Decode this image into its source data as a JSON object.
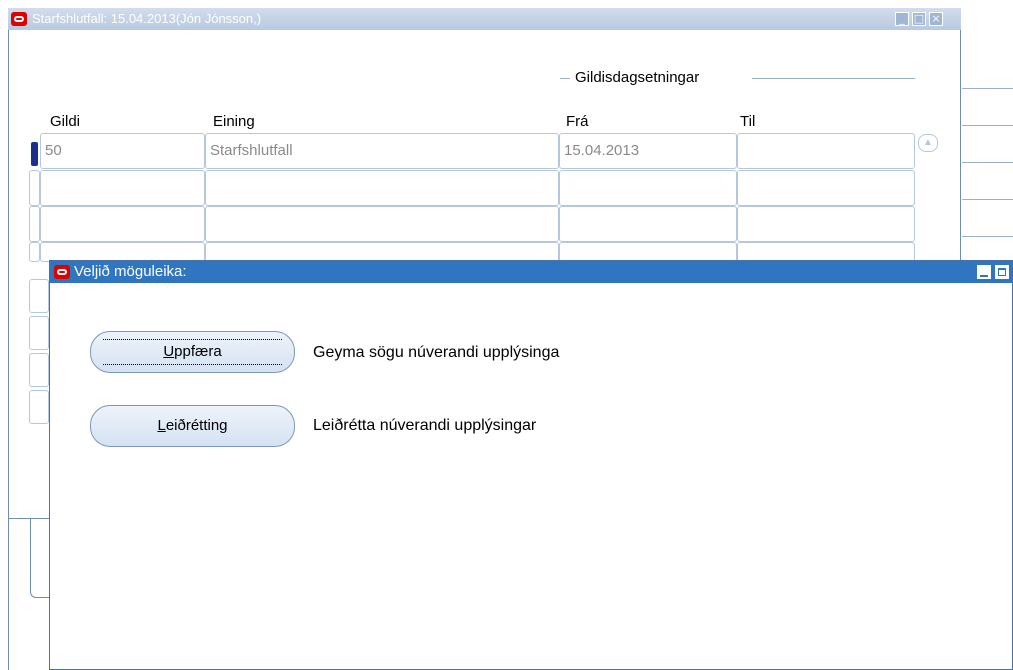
{
  "back_window": {
    "title": "Starfshlutfall: 15.04.2013(Jón Jónsson,)",
    "controls": {
      "minimize": "_",
      "maximize": "□",
      "close": "×"
    },
    "group_label": "Gildisdagsetningar",
    "columns": {
      "gildi": "Gildi",
      "eining": "Eining",
      "fra": "Frá",
      "til": "Til"
    },
    "rows": [
      {
        "gildi": "50",
        "eining": "Starfshlutfall",
        "fra": "15.04.2013",
        "til": ""
      }
    ]
  },
  "dialog": {
    "title": "Veljið möguleika:",
    "options": [
      {
        "button": "Uppfæra",
        "mnemonic": "U",
        "rest": "ppfæra",
        "description": "Geyma sögu núverandi upplýsinga"
      },
      {
        "button": "Leiðrétting",
        "mnemonic": "L",
        "rest": "eiðrétting",
        "description": "Leiðrétta núverandi upplýsingar"
      }
    ]
  }
}
